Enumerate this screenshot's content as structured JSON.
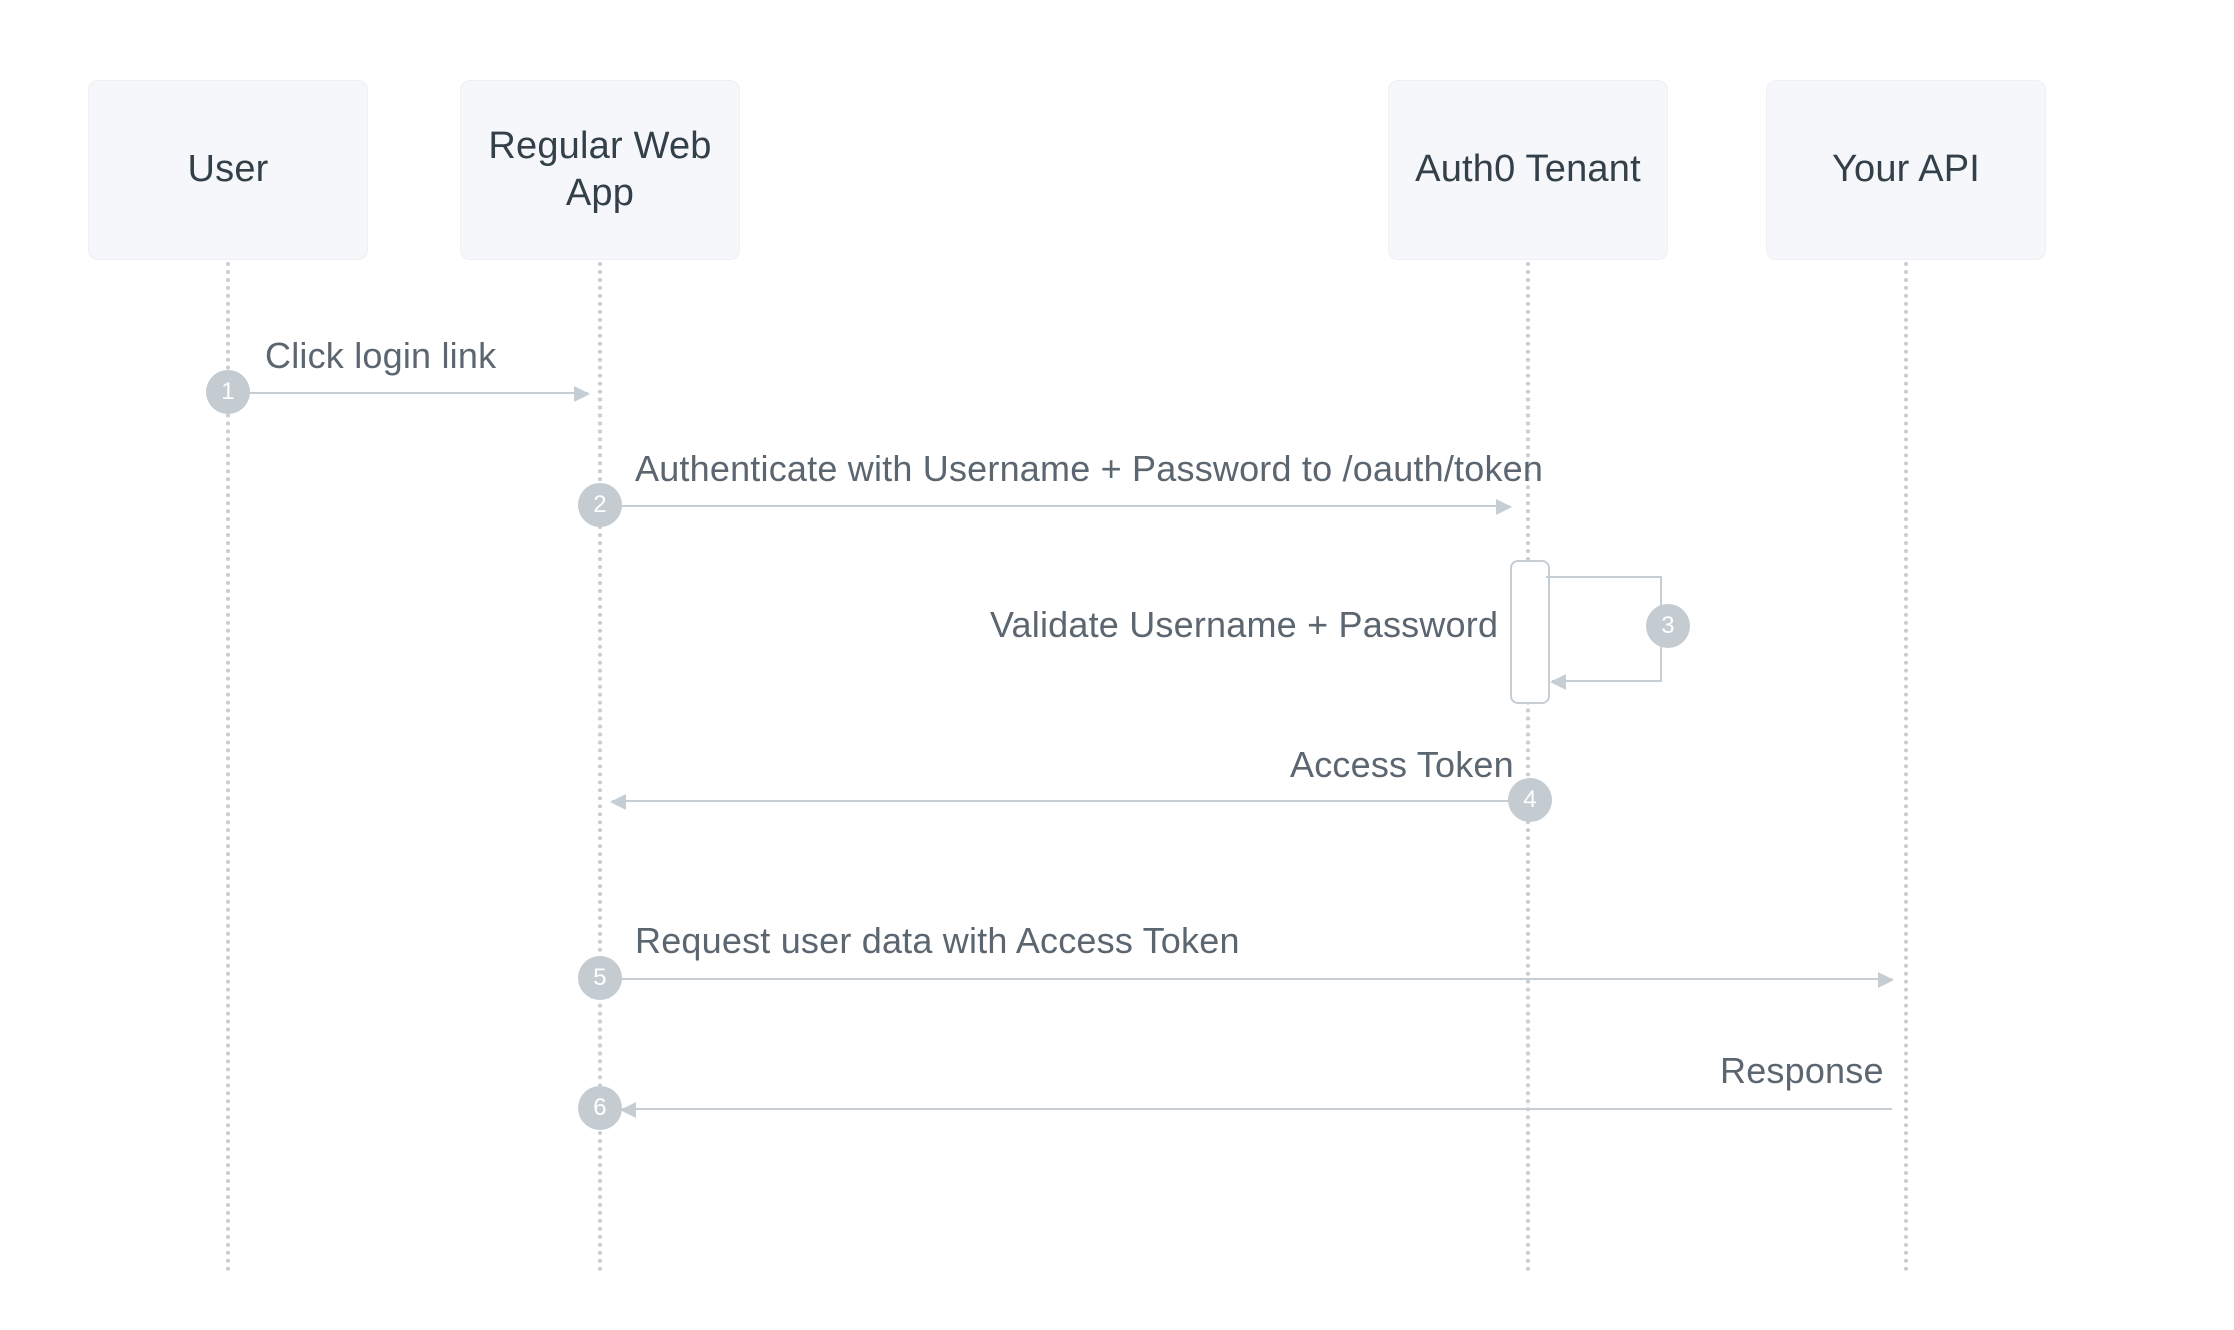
{
  "actors": {
    "user": {
      "label": "User"
    },
    "app": {
      "label": "Regular Web App"
    },
    "tenant": {
      "label": "Auth0 Tenant"
    },
    "api": {
      "label": "Your API"
    }
  },
  "steps": {
    "s1": {
      "num": "1",
      "label": "Click login link"
    },
    "s2": {
      "num": "2",
      "label": "Authenticate with Username + Password to /oauth/token"
    },
    "s3": {
      "num": "3",
      "label": "Validate Username + Password"
    },
    "s4": {
      "num": "4",
      "label": "Access Token"
    },
    "s5": {
      "num": "5",
      "label": "Request user data with Access Token"
    },
    "s6": {
      "num": "6",
      "label": "Response"
    }
  }
}
